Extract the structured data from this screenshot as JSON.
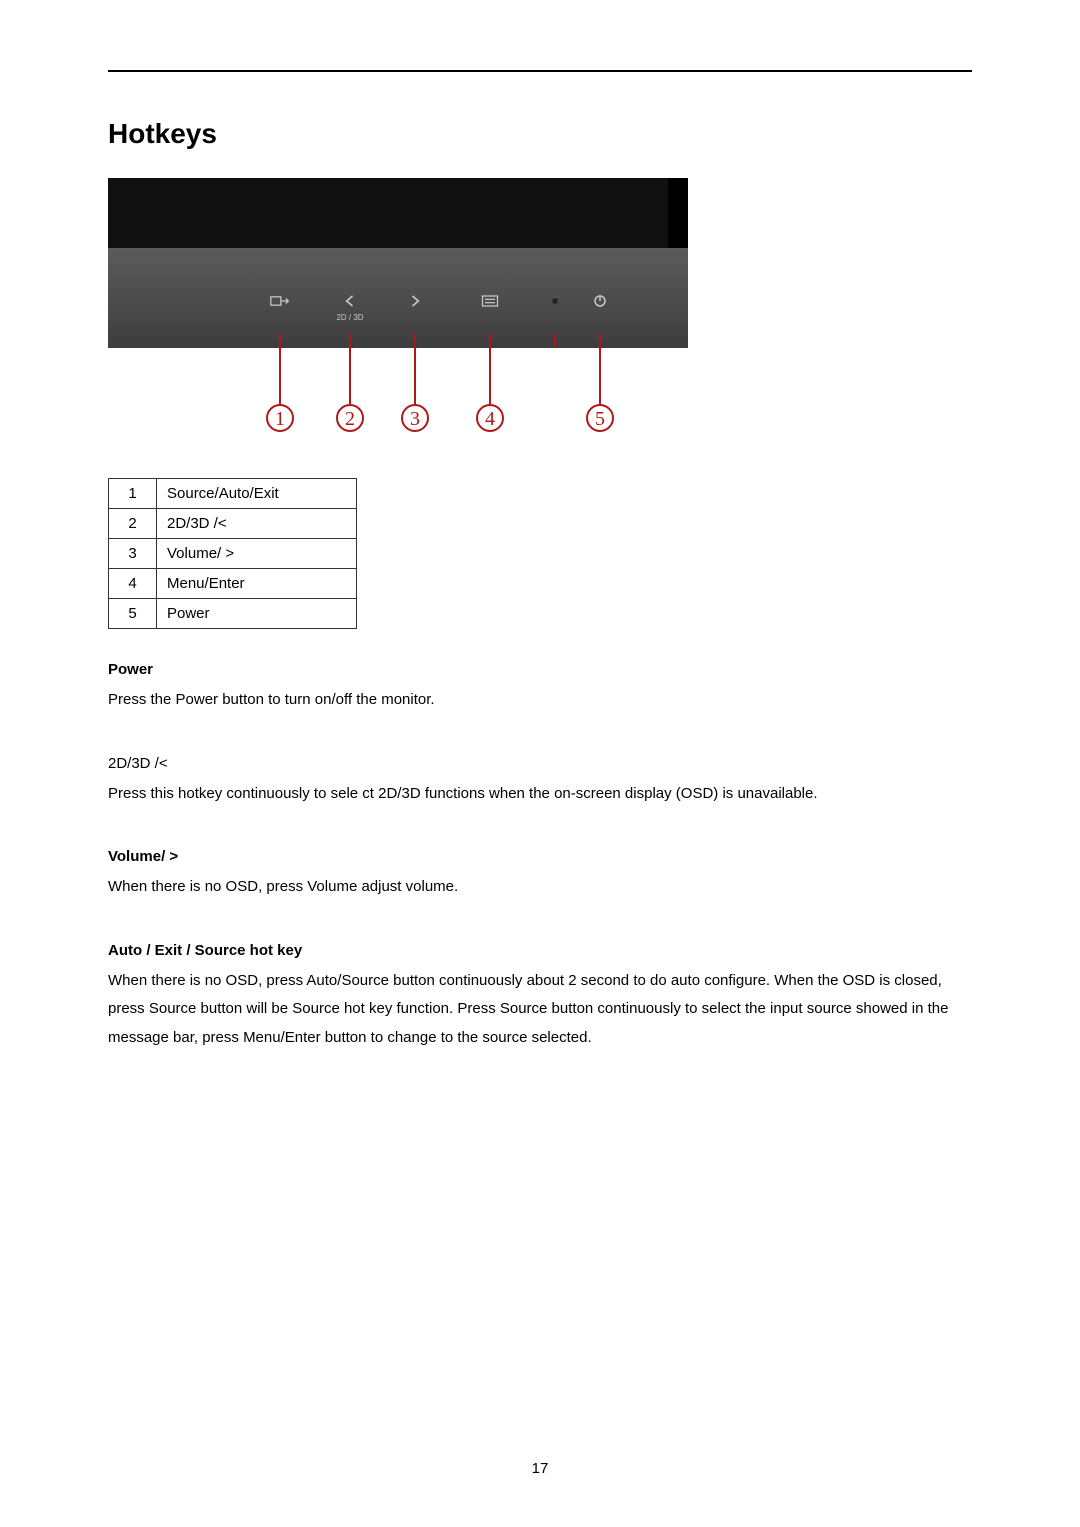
{
  "title": "Hotkeys",
  "diagram": {
    "sublabel_2d3d": "2D / 3D"
  },
  "buttons": [
    {
      "n": "1",
      "label": "Source/Auto/Exit"
    },
    {
      "n": "2",
      "label": "2D/3D /<"
    },
    {
      "n": "3",
      "label": "Volume/ >"
    },
    {
      "n": "4",
      "label": "Menu/Enter"
    },
    {
      "n": "5",
      "label": "Power"
    }
  ],
  "sections": {
    "power": {
      "heading": "Power",
      "body": "Press the Power button to turn on/off the monitor."
    },
    "mode": {
      "heading": "2D/3D /<",
      "body": "Press this hotkey continuously to sele  ct 2D/3D functions when the on-screen display (OSD) is unavailable."
    },
    "volume": {
      "heading": "Volume/ >",
      "body": "When there is no OSD, press Volume adjust volume."
    },
    "auto": {
      "heading": "Auto / Exit / Source hot key",
      "body": "When there is no OSD, press Auto/Source button continuously about 2 second to do auto configure. When the OSD is closed, press Source button will be Source hot key function. Press Source button continuously to select the input source showed in the message bar, press Menu/Enter button to change to the source selected."
    }
  },
  "page_number": "17"
}
